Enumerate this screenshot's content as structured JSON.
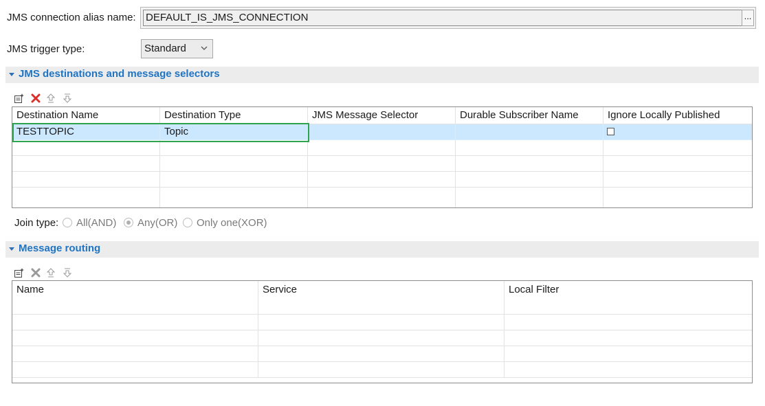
{
  "form": {
    "alias_label": "JMS connection alias name:",
    "alias_value": "DEFAULT_IS_JMS_CONNECTION",
    "browse_label": "...",
    "trigger_type_label": "JMS trigger type:",
    "trigger_type_value": "Standard"
  },
  "destinations": {
    "title": "JMS destinations and message selectors",
    "columns": [
      "Destination Name",
      "Destination Type",
      "JMS Message Selector",
      "Durable Subscriber Name",
      "Ignore Locally Published"
    ],
    "rows": [
      {
        "name": "TESTTOPIC",
        "type": "Topic",
        "selector": "",
        "durable": "",
        "ignore_local": false
      }
    ]
  },
  "join": {
    "label": "Join type:",
    "options": [
      "All(AND)",
      "Any(OR)",
      "Only one(XOR)"
    ],
    "selected": "Any(OR)"
  },
  "routing": {
    "title": "Message routing",
    "columns": [
      "Name",
      "Service",
      "Local Filter"
    ]
  },
  "colors": {
    "section_title": "#1f74c4",
    "selected_row": "#cce8ff",
    "highlight_border": "#2ea44f",
    "delete_icon": "#d9302c"
  },
  "icons": [
    "add-row-icon",
    "delete-icon",
    "move-up-icon",
    "move-down-icon",
    "chevron-down-icon",
    "collapse-triangle-icon"
  ]
}
